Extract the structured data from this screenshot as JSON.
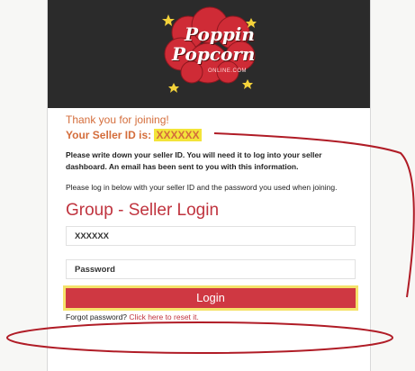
{
  "brand": {
    "logo_line1": "Poppin",
    "logo_line2": "Popcorn",
    "logo_sub": "ONLINE.COM"
  },
  "confirmation": {
    "thank_you": "Thank you for joining!",
    "seller_id_label": "Your Seller ID is:",
    "seller_id_value": "XXXXXX",
    "notice": "Please write down your seller ID. You will need it to log into your seller dashboard. An email has been sent to you with this information.",
    "login_info": "Please log in below with your seller ID and the password you used when joining."
  },
  "login_form": {
    "title": "Group - Seller Login",
    "seller_id_field": "XXXXXX",
    "password_placeholder": "Password",
    "login_button": "Login",
    "forgot_text": "Forgot password?",
    "reset_link": "Click here to reset it."
  },
  "colors": {
    "header_bg": "#2b2b2b",
    "accent_orange": "#d46d3b",
    "accent_red": "#c0343f",
    "button_red": "#cf3842",
    "highlight_yellow": "#f3e43a",
    "annotation_red": "#b01c26"
  }
}
